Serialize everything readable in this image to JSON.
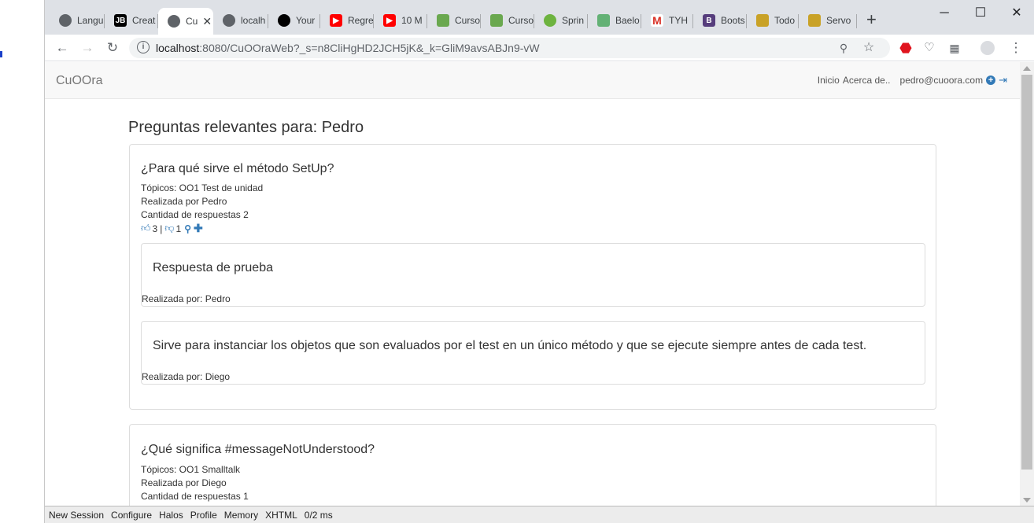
{
  "browser": {
    "tabs": [
      {
        "title": "Langu",
        "icon": "globe-icon",
        "color": "#5f6368"
      },
      {
        "title": "Creat",
        "icon": "jb-icon",
        "color": "#000000"
      },
      {
        "title": "Cu",
        "icon": "globe-icon",
        "color": "#5f6368",
        "active": true
      },
      {
        "title": "localh",
        "icon": "globe-icon",
        "color": "#5f6368"
      },
      {
        "title": "Your",
        "icon": "github-icon",
        "color": "#000000"
      },
      {
        "title": "Regre",
        "icon": "youtube-icon",
        "color": "#ff0000"
      },
      {
        "title": "10 M",
        "icon": "youtube-icon",
        "color": "#ff0000"
      },
      {
        "title": "Curso",
        "icon": "course-icon",
        "color": "#6aa84f"
      },
      {
        "title": "Curso",
        "icon": "course-icon",
        "color": "#6aa84f"
      },
      {
        "title": "Sprin",
        "icon": "spring-icon",
        "color": "#6db33f"
      },
      {
        "title": "Baelo",
        "icon": "baeldung-icon",
        "color": "#63b175"
      },
      {
        "title": "TYH",
        "icon": "gmail-icon",
        "color": "#d93025"
      },
      {
        "title": "Boots",
        "icon": "bootstrap-icon",
        "color": "#563d7c"
      },
      {
        "title": "Todo",
        "icon": "todo-icon",
        "color": "#c9a227"
      },
      {
        "title": "Servo",
        "icon": "todo-icon",
        "color": "#c9a227"
      }
    ],
    "url_host": "localhost",
    "url_rest": ":8080/CuOOraWeb?_s=n8CliHgHD2JCH5jK&_k=GliM9avsABJn9-vW"
  },
  "navbar": {
    "brand": "CuOOra",
    "links": [
      "Inicio",
      "Acerca de.."
    ],
    "user_email": "pedro@cuoora.com"
  },
  "page_title": "Preguntas relevantes para: Pedro",
  "questions": [
    {
      "title": "¿Para qué sirve el método SetUp?",
      "topics": "Tópicos: OO1 Test de unidad",
      "author": "Realizada por Pedro",
      "answers_count": "Cantidad de respuestas 2",
      "likes": "3",
      "dislikes": "1",
      "answers": [
        {
          "text": "Respuesta de prueba",
          "author": "Realizada por: Pedro"
        },
        {
          "text": "Sirve para instanciar los objetos que son evaluados por el test en un único método y que se ejecute siempre antes de cada test.",
          "author": "Realizada por: Diego"
        }
      ]
    },
    {
      "title": "¿Qué significa #messageNotUnderstood?",
      "topics": "Tópicos: OO1 Smalltalk",
      "author": "Realizada por Diego",
      "answers_count": "Cantidad de respuestas 1"
    }
  ],
  "devbar": [
    "New Session",
    "Configure",
    "Halos",
    "Profile",
    "Memory",
    "XHTML",
    "0/2 ms"
  ]
}
